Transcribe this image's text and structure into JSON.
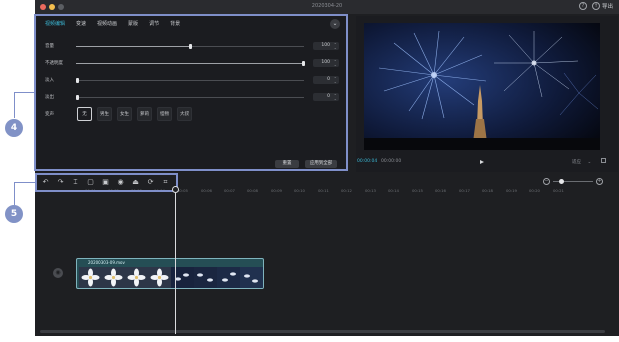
{
  "window": {
    "title": "2020304-20"
  },
  "titlebar": {
    "export_label": "导出",
    "help_icon": "question-icon"
  },
  "markers": {
    "first": "4",
    "second": "5"
  },
  "tabs": [
    "视频编辑",
    "变速",
    "视频动画",
    "蒙版",
    "调节",
    "背景"
  ],
  "active_tab_index": 0,
  "sliders": [
    {
      "label": "音量",
      "value": "100",
      "fraction": 0.5
    },
    {
      "label": "不透明度",
      "value": "100",
      "fraction": 1.0
    },
    {
      "label": "淡入",
      "value": "0",
      "fraction": 0.0
    },
    {
      "label": "淡出",
      "value": "0",
      "fraction": 0.0
    }
  ],
  "voice": {
    "label": "变声",
    "options": [
      "无",
      "男生",
      "女生",
      "萝莉",
      "怪物",
      "大叔"
    ],
    "selected_index": 0
  },
  "buttons": {
    "reset": "重置",
    "apply_all": "应用到全部"
  },
  "preview": {
    "current_time": "00:00:04",
    "duration": "00:00:00",
    "adapt_label": "适应",
    "adapt_chevron": "⌄"
  },
  "toolbar": [
    "undo-icon",
    "redo-icon",
    "split-icon",
    "delete-icon",
    "freeze-icon",
    "record-icon",
    "mirror-icon",
    "rotate-icon",
    "crop-icon"
  ],
  "timeline": {
    "ticks": [
      "00:01",
      "00:02",
      "00:03",
      "00:04",
      "00:05",
      "00:06",
      "00:07",
      "00:08",
      "00:09",
      "00:10",
      "00:11",
      "00:12",
      "00:13",
      "00:14",
      "00:15",
      "00:16",
      "00:17",
      "00:18",
      "00:19",
      "00:20",
      "00:21"
    ],
    "clip_title": "20200303-09.mov"
  },
  "colors": {
    "accent": "#3bb7d4",
    "highlight": "#7f8fc9",
    "marker": "#8192c6",
    "clip": "#254e55"
  }
}
